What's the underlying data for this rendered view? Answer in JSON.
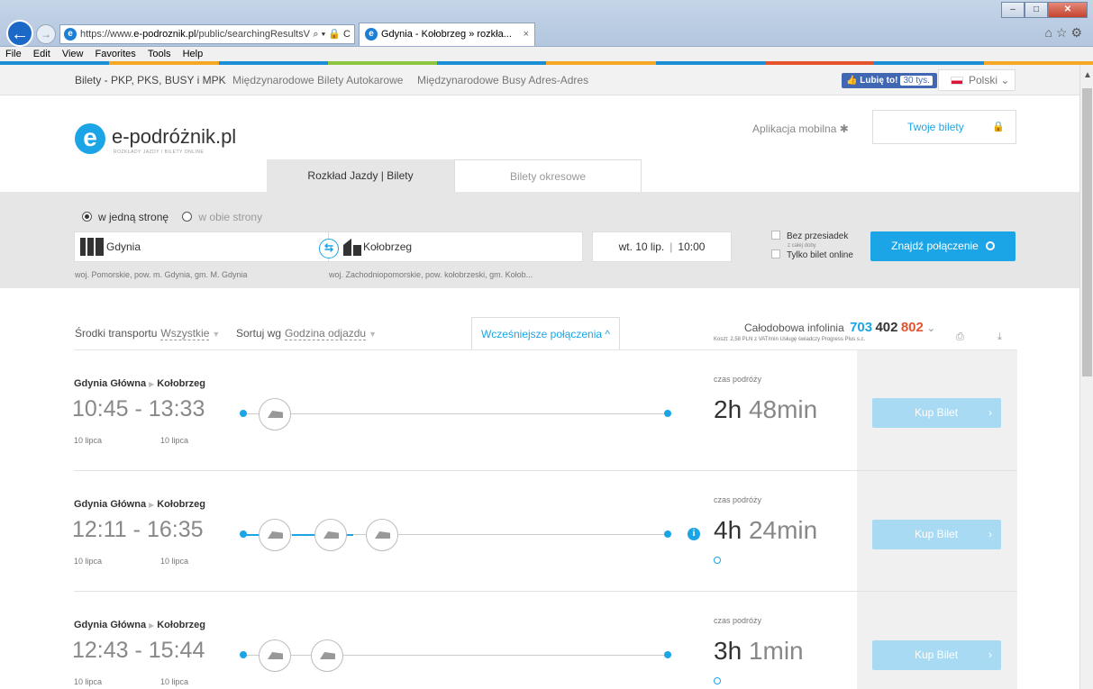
{
  "browser": {
    "url_prefix": "https://www.",
    "url_domain": "e-podroznik.pl",
    "url_rest": "/public/searchingResultsV\\",
    "addr_tools": "⌕ ▾ 🔒 C",
    "tab_title": "Gdynia - Kołobrzeg » rozkła...",
    "tab_close": "×",
    "menu": [
      "File",
      "Edit",
      "View",
      "Favorites",
      "Tools",
      "Help"
    ],
    "colors": [
      "#1a8fd6",
      "#f5a623",
      "#1a8fd6",
      "#8cc63f",
      "#1a8fd6",
      "#f5a623",
      "#1a8fd6",
      "#e5532d",
      "#1a8fd6",
      "#f5a623"
    ]
  },
  "topnav": {
    "links": [
      "Bilety - PKP, PKS, BUSY i MPK",
      "Międzynarodowe Bilety Autokarowe",
      "Międzynarodowe Busy Adres-Adres"
    ],
    "fb_like": "Lubię to!",
    "fb_count": "30 tys.",
    "language": "Polski"
  },
  "header": {
    "logo_letter": "e",
    "logo_name": "e-podróżnik.pl",
    "logo_tagline": "ROZKŁADY JAZDY / BILETY ONLINE",
    "mobile_app": "Aplikacja mobilna",
    "my_tickets": "Twoje bilety",
    "tabs": [
      "Rozkład Jazdy | Bilety",
      "Bilety okresowe"
    ]
  },
  "search": {
    "trip_one_way": "w jedną stronę",
    "trip_round": "w obie strony",
    "from": "Gdynia",
    "to": "Kołobrzeg",
    "date": "wt. 10 lip.",
    "time": "10:00",
    "no_transfers": "Bez przesiadek",
    "no_transfers_sub": "z całej doby",
    "online_only": "Tylko bilet online",
    "find_button": "Znajdź połączenie",
    "from_region": "woj. Pomorskie, pow. m. Gdynia, gm. M. Gdynia",
    "to_region": "woj. Zachodniopomorskie, pow. kołobrzeski, gm. Kołob..."
  },
  "filters": {
    "transport_label": "Środki transportu",
    "transport_value": "Wszystkie",
    "sort_label": "Sortuj wg",
    "sort_value": "Godzina odjazdu",
    "earlier_button": "Wcześniejsze połączenia",
    "infoline_label": "Całodobowa infolinia",
    "infoline_a": "703",
    "infoline_b": "402",
    "infoline_c": "802",
    "infoline_cost": "Koszt: 2,58 PLN z VAT/min Usługę świadczy Progress Plus s.c."
  },
  "results": [
    {
      "from": "Gdynia Główna",
      "to": "Kołobrzeg",
      "depart": "10:45",
      "arrive": "13:33",
      "date_dep": "10 lipca",
      "date_arr": "10 lipca",
      "dur_label": "czas podróży",
      "dur_h": "2h",
      "dur_min": "48min",
      "buy": "Kup Bilet"
    },
    {
      "from": "Gdynia Główna",
      "to": "Kołobrzeg",
      "depart": "12:11",
      "arrive": "16:35",
      "date_dep": "10 lipca",
      "date_arr": "10 lipca",
      "dur_label": "czas podróży",
      "dur_h": "4h",
      "dur_min": "24min",
      "buy": "Kup Bilet"
    },
    {
      "from": "Gdynia Główna",
      "to": "Kołobrzeg",
      "depart": "12:43",
      "arrive": "15:44",
      "date_dep": "10 lipca",
      "date_arr": "10 lipca",
      "dur_label": "czas podróży",
      "dur_h": "3h",
      "dur_min": "1min",
      "buy": "Kup Bilet"
    }
  ]
}
